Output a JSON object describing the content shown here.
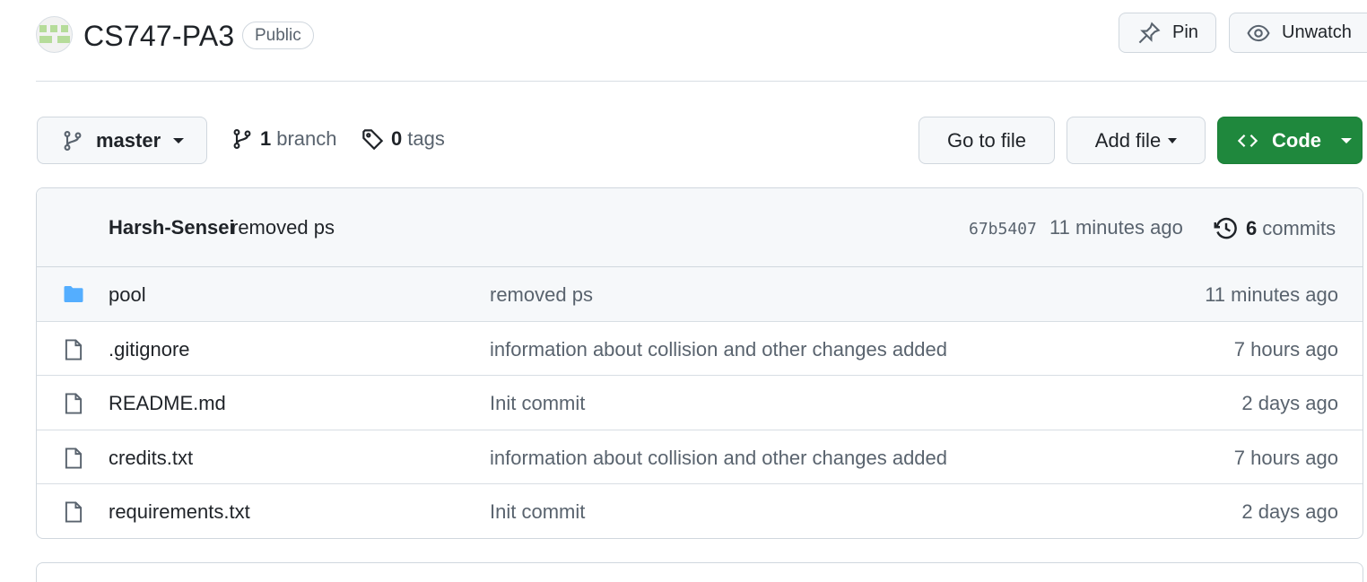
{
  "repo": {
    "name": "CS747-PA3",
    "visibility": "Public",
    "pin_label": "Pin",
    "watch_label": "Unwatch"
  },
  "toolbar": {
    "branch_name": "master",
    "branch_count": "1",
    "branch_label": "branch",
    "tag_count": "0",
    "tag_label": "tags",
    "goto_label": "Go to file",
    "add_file_label": "Add file",
    "code_label": "Code"
  },
  "latest_commit": {
    "author": "Harsh-Sensei",
    "message": "removed ps",
    "sha": "67b5407",
    "time": "11 minutes ago",
    "commit_count": "6",
    "commit_label": "commits"
  },
  "files": [
    {
      "name": "pool",
      "type": "folder",
      "icon": "folder-icon",
      "commit": "removed ps",
      "time": "11 minutes ago"
    },
    {
      "name": ".gitignore",
      "type": "file",
      "icon": "file-icon",
      "commit": "information about collision and other changes added",
      "time": "7 hours ago"
    },
    {
      "name": "README.md",
      "type": "file",
      "icon": "file-icon",
      "commit": "Init commit",
      "time": "2 days ago"
    },
    {
      "name": "credits.txt",
      "type": "file",
      "icon": "file-icon",
      "commit": "information about collision and other changes added",
      "time": "7 hours ago"
    },
    {
      "name": "requirements.txt",
      "type": "file",
      "icon": "file-icon",
      "commit": "Init commit",
      "time": "2 days ago"
    }
  ],
  "colors": {
    "code_button": "#1f883d",
    "folder_icon": "#54aeff"
  }
}
